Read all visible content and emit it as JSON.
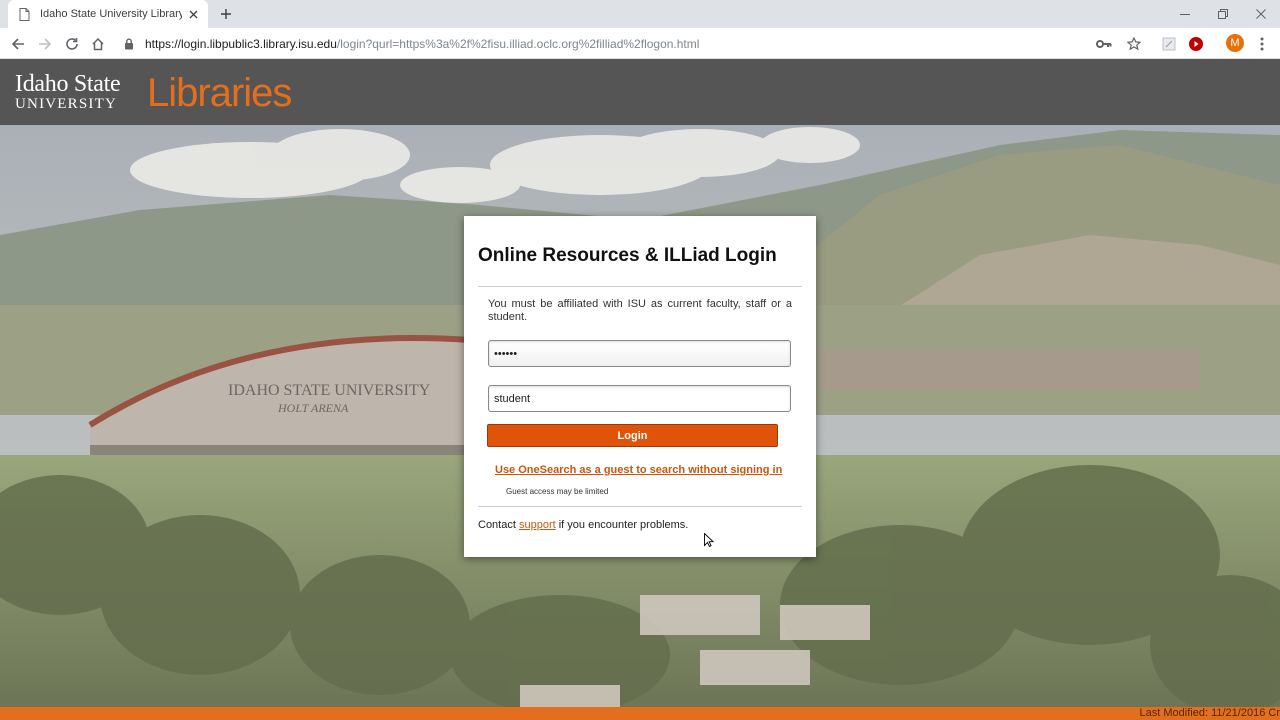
{
  "browser": {
    "tab_title": "Idaho State University Library Da",
    "url_host": "https://login.libpublic3.library.isu.edu",
    "url_path": "/login?qurl=https%3a%2f%2fisu.illiad.oclc.org%2filliad%2flogon.html",
    "profile_initial": "M",
    "icons": [
      "page-icon",
      "close-icon",
      "plus-icon",
      "minimize-icon",
      "restore-icon",
      "window-close-icon",
      "back-icon",
      "forward-icon",
      "reload-icon",
      "home-icon",
      "lock-icon",
      "key-icon",
      "star-icon",
      "extension-icon",
      "youtube-icon"
    ]
  },
  "header": {
    "logo_line1": "Idaho State",
    "logo_line2": "UNIVERSITY",
    "logo_libraries": "Libraries"
  },
  "hero": {
    "arena_line1": "IDAHO STATE UNIVERSITY",
    "arena_line2": "HOLT ARENA"
  },
  "login": {
    "title": "Online Resources & ILLiad Login",
    "notice": "You must be affiliated with ISU as current faculty, staff or a student.",
    "password_value": "••••••",
    "username_value": "student",
    "login_button": "Login",
    "guest_link": "Use OneSearch as a guest to search without signing in",
    "guest_note": "Guest access may be limited",
    "contact_prefix": "Contact ",
    "contact_link": "support",
    "contact_suffix": " if you encounter problems."
  },
  "footer": {
    "last_modified": "Last Modified: 11/21/2016 Cr"
  },
  "colors": {
    "accent": "#e36f1e",
    "button": "#e0530a",
    "header_bg": "#555555"
  }
}
